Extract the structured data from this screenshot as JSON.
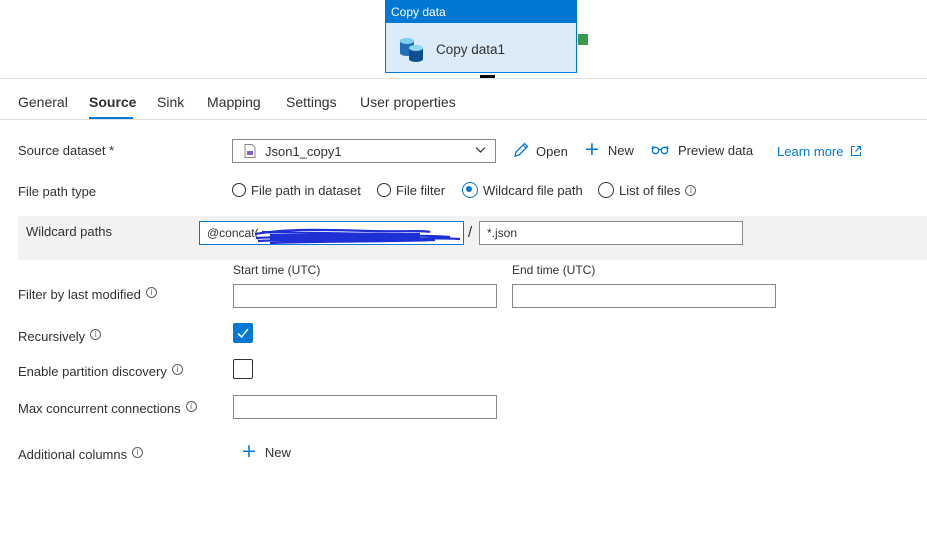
{
  "activity": {
    "type_label": "Copy data",
    "name": "Copy data1"
  },
  "tabs": [
    {
      "label": "General",
      "active": false
    },
    {
      "label": "Source",
      "active": true
    },
    {
      "label": "Sink",
      "active": false
    },
    {
      "label": "Mapping",
      "active": false
    },
    {
      "label": "Settings",
      "active": false
    },
    {
      "label": "User properties",
      "active": false
    }
  ],
  "source_dataset": {
    "label": "Source dataset",
    "required_mark": "*",
    "value": "Json1_copy1",
    "open_label": "Open",
    "new_label": "New",
    "preview_label": "Preview data",
    "learn_more_label": "Learn more"
  },
  "file_path_type": {
    "label": "File path type",
    "options": [
      "File path in dataset",
      "File filter",
      "Wildcard file path",
      "List of files"
    ],
    "selected": "Wildcard file path"
  },
  "wildcard_paths": {
    "label": "Wildcard paths",
    "folder_value": "@concat(",
    "separator": "/",
    "file_value": "*.json"
  },
  "filter_by_last_modified": {
    "label": "Filter by last modified",
    "start_label": "Start time (UTC)",
    "end_label": "End time (UTC)",
    "start_value": "",
    "end_value": ""
  },
  "recursively": {
    "label": "Recursively",
    "checked": true
  },
  "partition_discovery": {
    "label": "Enable partition discovery",
    "checked": false
  },
  "max_connections": {
    "label": "Max concurrent connections",
    "value": ""
  },
  "additional_columns": {
    "label": "Additional columns",
    "new_label": "New"
  },
  "colors": {
    "accent": "#0078d4",
    "card_bg": "#dcebf8",
    "connector": "#3a9a4a",
    "scribble": "#1f2fd6"
  }
}
